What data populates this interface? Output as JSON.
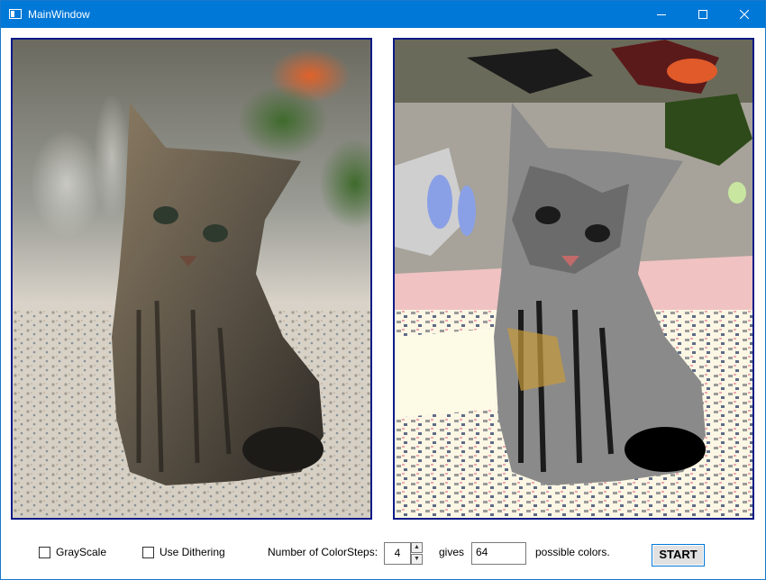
{
  "window": {
    "title": "MainWindow"
  },
  "titlebar": {
    "icons": [
      "app-icon",
      "minimize-icon",
      "maximize-icon",
      "close-icon"
    ]
  },
  "images": {
    "left": {
      "subject": "kitten",
      "variant": "original"
    },
    "right": {
      "subject": "kitten",
      "variant": "posterized"
    }
  },
  "controls": {
    "grayscale": {
      "label": "GrayScale",
      "checked": false
    },
    "dithering": {
      "label": "Use Dithering",
      "checked": false
    },
    "color_steps": {
      "label": "Number of ColorSteps:",
      "value": "4"
    },
    "gives_label": "gives",
    "possible_colors": {
      "value": "64",
      "suffix": "possible colors."
    },
    "start_label": "START"
  },
  "colors": {
    "titlebar": "#0078d7",
    "image_border": "#0a1a86"
  }
}
